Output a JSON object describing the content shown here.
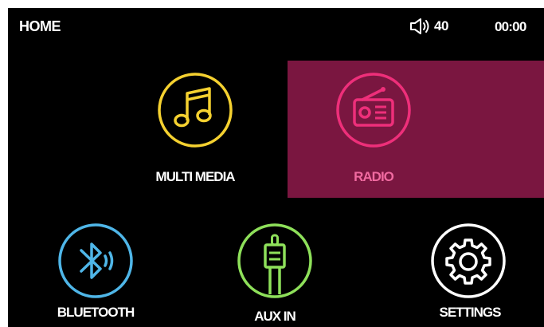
{
  "status": {
    "title": "HOME",
    "volume_icon": "speaker-icon",
    "volume": "40",
    "clock": "00:00"
  },
  "menu": {
    "selected": "radio",
    "items": [
      {
        "id": "multimedia",
        "label": "MULTI MEDIA",
        "icon": "music-note-icon",
        "color": "#f5d130"
      },
      {
        "id": "radio",
        "label": "RADIO",
        "icon": "radio-icon",
        "color": "#ee2f7a"
      },
      {
        "id": "bluetooth",
        "label": "BLUETOOTH",
        "icon": "bluetooth-icon",
        "color": "#4fb6e8"
      },
      {
        "id": "aux",
        "label": "AUX IN",
        "icon": "aux-plug-icon",
        "color": "#8ee05a"
      },
      {
        "id": "settings",
        "label": "SETTINGS",
        "icon": "gear-icon",
        "color": "#ffffff"
      }
    ]
  },
  "colors": {
    "background": "#000000",
    "selected_tile": "#7a1640",
    "selected_text": "#f06aa0"
  }
}
